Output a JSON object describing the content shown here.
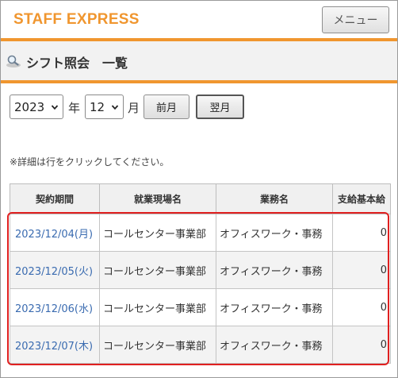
{
  "header": {
    "brand": "STAFF EXPRESS",
    "menu_label": "メニュー"
  },
  "page": {
    "title": "シフト照会　一覧",
    "title_icon": "search-icon"
  },
  "filters": {
    "year_value": "2023",
    "year_unit": "年",
    "month_value": "12",
    "month_unit": "月",
    "prev_label": "前月",
    "next_label": "翌月"
  },
  "hint": "※詳細は行をクリックしてください。",
  "table": {
    "headers": [
      "契約期間",
      "就業現場名",
      "業務名",
      "支給基本給"
    ],
    "rows": [
      {
        "date": "2023/12/04(月)",
        "site": "コールセンター事業部",
        "job": "オフィスワーク・事務",
        "pay": "0"
      },
      {
        "date": "2023/12/05(火)",
        "site": "コールセンター事業部",
        "job": "オフィスワーク・事務",
        "pay": "0"
      },
      {
        "date": "2023/12/06(水)",
        "site": "コールセンター事業部",
        "job": "オフィスワーク・事務",
        "pay": "0"
      },
      {
        "date": "2023/12/07(木)",
        "site": "コールセンター事業部",
        "job": "オフィスワーク・事務",
        "pay": "0"
      }
    ]
  },
  "colors": {
    "brand": "#f0962f",
    "link": "#3a6bb0",
    "highlight": "#e02020"
  }
}
